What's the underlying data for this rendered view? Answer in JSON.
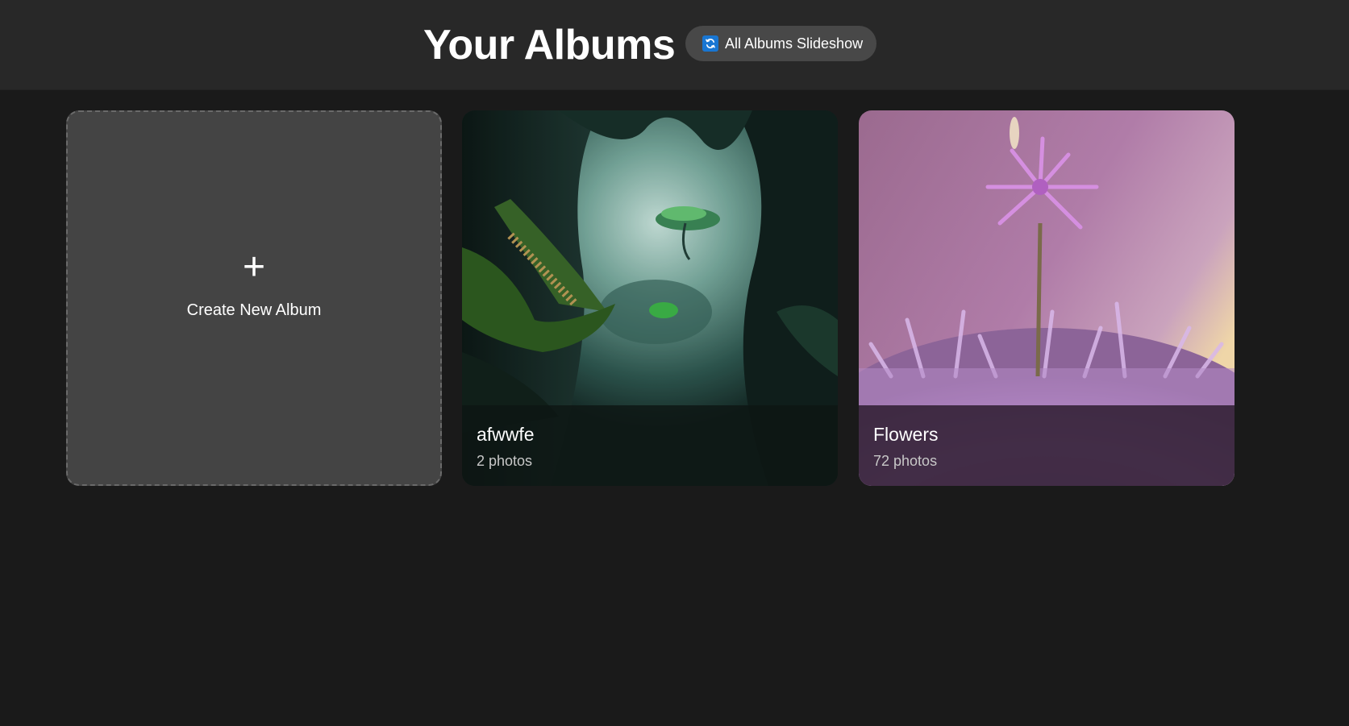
{
  "header": {
    "title": "Your Albums",
    "slideshow_button": {
      "label": "All Albums Slideshow",
      "icon": "refresh-icon",
      "icon_color": "#1976d2"
    }
  },
  "create_album": {
    "icon": "plus-icon",
    "icon_glyph": "+",
    "label": "Create New Album"
  },
  "albums": [
    {
      "name": "afwwfe",
      "count": "2 photos",
      "thumbnail": "misty-jungle-forest-image"
    },
    {
      "name": "Flowers",
      "count": "72 photos",
      "thumbnail": "purple-allium-flowers-image"
    }
  ],
  "colors": {
    "background": "#1a1a1a",
    "header": "#282828",
    "button": "#484848",
    "create_card": "#444444"
  }
}
